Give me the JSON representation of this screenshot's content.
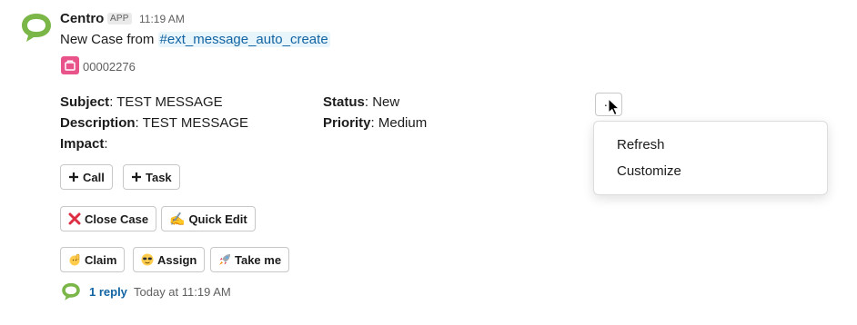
{
  "message": {
    "sender": "Centro",
    "app_badge": "APP",
    "timestamp": "11:19 AM",
    "text_prefix": "New Case from ",
    "channel": "#ext_message_auto_create",
    "case_number": "00002276"
  },
  "fields": {
    "subject_label": "Subject",
    "subject_value": "TEST MESSAGE",
    "description_label": "Description",
    "description_value": "TEST MESSAGE",
    "impact_label": "Impact",
    "impact_value": "",
    "status_label": "Status",
    "status_value": "New",
    "priority_label": "Priority",
    "priority_value": "Medium"
  },
  "buttons": {
    "call": "Call",
    "task": "Task",
    "close_case": "Close Case",
    "quick_edit": "Quick Edit",
    "claim": "Claim",
    "assign": "Assign",
    "take_me": "Take me"
  },
  "overflow_menu": {
    "button_label": "···",
    "items": [
      "Refresh",
      "Customize"
    ]
  },
  "thread": {
    "reply_count": "1 reply",
    "reply_time": "Today at 11:19 AM"
  },
  "icons": {
    "avatar": "centro-logo-icon",
    "case": "briefcase-icon",
    "call": "plus-icon",
    "task": "plus-icon",
    "close_case": "red-x-icon",
    "quick_edit": "writing-hand-icon",
    "claim": "raised-hand-icon",
    "assign": "sunglasses-face-icon",
    "take_me": "rocket-icon",
    "cursor": "mouse-pointer-icon"
  },
  "colors": {
    "brand_green": "#7ab648",
    "link_blue": "#1264a3",
    "channel_bg": "#e8f5fa",
    "case_pink": "#e8538a"
  }
}
